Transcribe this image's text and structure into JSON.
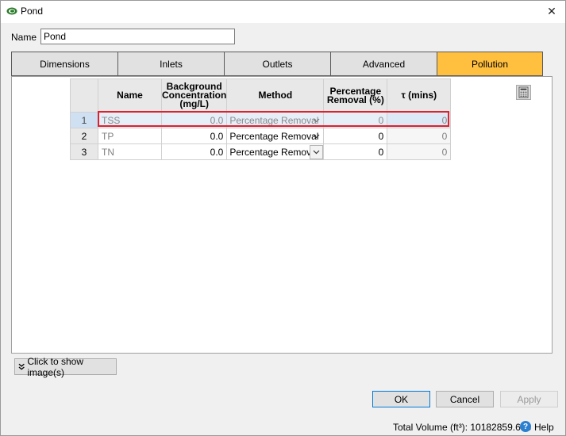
{
  "window": {
    "title": "Pond",
    "close_glyph": "✕",
    "icon": "pond-icon"
  },
  "name_field": {
    "label": "Name",
    "value": "Pond"
  },
  "tabs": [
    {
      "label": "Dimensions",
      "active": false
    },
    {
      "label": "Inlets",
      "active": false
    },
    {
      "label": "Outlets",
      "active": false
    },
    {
      "label": "Advanced",
      "active": false
    },
    {
      "label": "Pollution",
      "active": true
    }
  ],
  "grid": {
    "headers": {
      "name": "Name",
      "background_line1": "Background",
      "background_line2": "Concentration",
      "background_line3": "(mg/L)",
      "method": "Method",
      "removal_line1": "Percentage",
      "removal_line2": "Removal (%)",
      "tau": "τ (mins)"
    },
    "rows": [
      {
        "num": "1",
        "name": "TSS",
        "background": "0.0",
        "method": "Percentage Removal",
        "removal": "0",
        "tau": "0"
      },
      {
        "num": "2",
        "name": "TP",
        "background": "0.0",
        "method": "Percentage Removal",
        "removal": "0",
        "tau": "0"
      },
      {
        "num": "3",
        "name": "TN",
        "background": "0.0",
        "method": "Percentage Removal",
        "removal": "0",
        "tau": "0"
      }
    ],
    "selected_row": 1
  },
  "show_images_button": "Click to show image(s)",
  "buttons": {
    "ok": "OK",
    "cancel": "Cancel",
    "apply": "Apply"
  },
  "status": {
    "total_volume": "Total Volume (ft³): 10182859.633",
    "help": "Help"
  },
  "colors": {
    "active_tab": "#ffbf3f",
    "selection_outline": "#e0202b",
    "help_icon": "#2a7fd0"
  }
}
